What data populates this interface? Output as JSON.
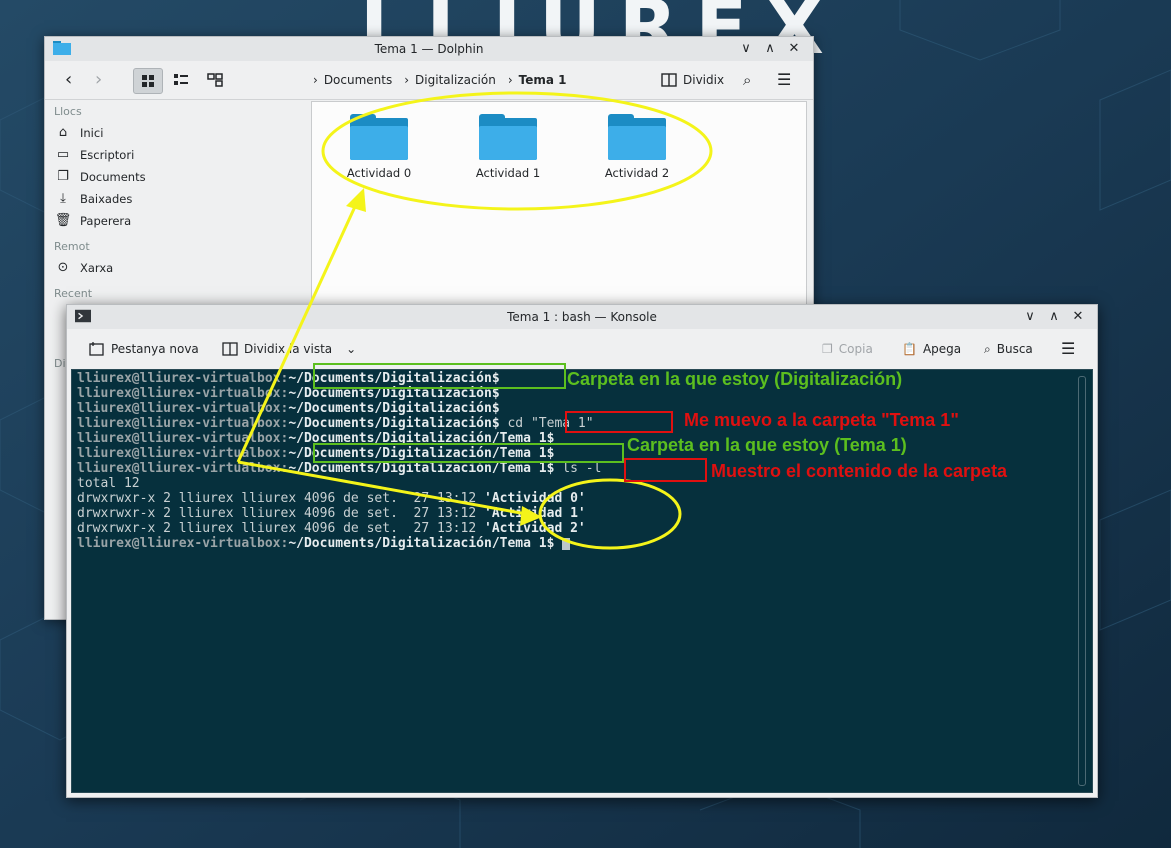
{
  "wallpaper": {
    "logo_text": "LLIUREX"
  },
  "dolphin": {
    "title": "Tema 1 — Dolphin",
    "breadcrumb": [
      "Documents",
      "Digitalización",
      "Tema 1"
    ],
    "split_label": "Dividix",
    "places_header": "Llocs",
    "places": [
      "Inici",
      "Escriptori",
      "Documents",
      "Baixades",
      "Paperera"
    ],
    "remote_header": "Remot",
    "remote": [
      "Xarxa"
    ],
    "recent_header": "Recent",
    "partial_header": "Di",
    "folders": [
      "Actividad 0",
      "Actividad 1",
      "Actividad 2"
    ]
  },
  "konsole": {
    "title": "Tema 1 : bash — Konsole",
    "new_tab": "Pestanya nova",
    "split_view": "Dividix la vista",
    "copy": "Copia",
    "paste": "Apega",
    "search": "Busca",
    "lines": [
      {
        "user": "lliurex@lliurex-virtualbox:",
        "path": "~/Documents/Digitalización$",
        "cmd": ""
      },
      {
        "user": "lliurex@lliurex-virtualbox:",
        "path": "~/Documents/Digitalización$",
        "cmd": ""
      },
      {
        "user": "lliurex@lliurex-virtualbox:",
        "path": "~/Documents/Digitalización$",
        "cmd": ""
      },
      {
        "user": "lliurex@lliurex-virtualbox:",
        "path": "~/Documents/Digitalización$",
        "cmd": " cd \"Tema 1\""
      },
      {
        "user": "lliurex@lliurex-virtualbox:",
        "path": "~/Documents/Digitalización/Tema 1$",
        "cmd": ""
      },
      {
        "user": "lliurex@lliurex-virtualbox:",
        "path": "~/Documents/Digitalización/Tema 1$",
        "cmd": ""
      },
      {
        "user": "lliurex@lliurex-virtualbox:",
        "path": "~/Documents/Digitalización/Tema 1$",
        "cmd": " ls -l"
      }
    ],
    "total": "total 12",
    "listing": [
      {
        "perms": "drwxrwxr-x 2 lliurex lliurex 4096 de set.  27 13:12 ",
        "name": "'Actividad 0'"
      },
      {
        "perms": "drwxrwxr-x 2 lliurex lliurex 4096 de set.  27 13:12 ",
        "name": "'Actividad 1'"
      },
      {
        "perms": "drwxrwxr-x 2 lliurex lliurex 4096 de set.  27 13:12 ",
        "name": "'Actividad 2'"
      }
    ],
    "last_prompt": {
      "user": "lliurex@lliurex-virtualbox:",
      "path": "~/Documents/Digitalización/Tema 1$"
    }
  },
  "annotations": {
    "note1": "Carpeta en la que estoy (Digitalización)",
    "note2": "Me muevo a la carpeta \"Tema 1\"",
    "note3": "Carpeta en la que estoy (Tema 1)",
    "note4": "Muestro el contenido de la carpeta",
    "green": "#5cbf1f",
    "red": "#e01010",
    "yellow": "#f4f41a"
  }
}
